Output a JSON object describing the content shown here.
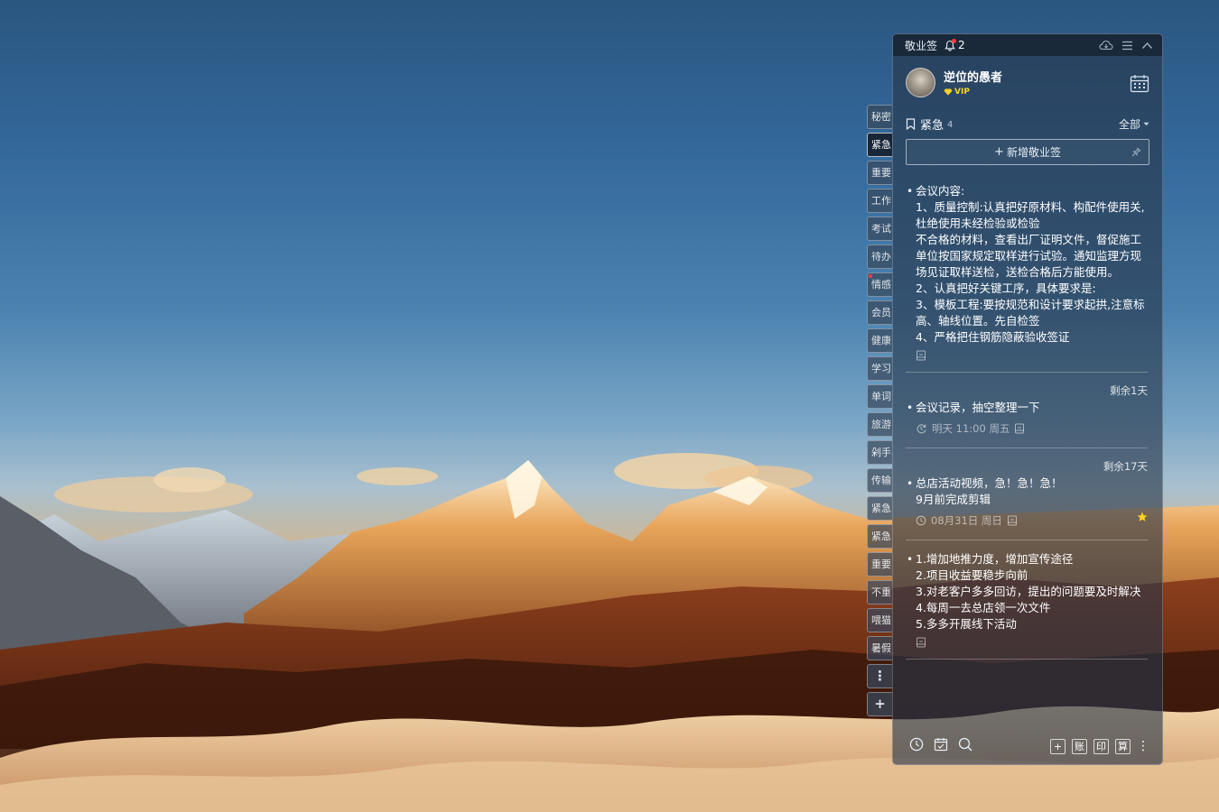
{
  "side_tabs": [
    {
      "label": "秘密",
      "active": false,
      "dot": false
    },
    {
      "label": "紧急",
      "active": true,
      "dot": false
    },
    {
      "label": "重要",
      "active": false,
      "dot": false
    },
    {
      "label": "工作",
      "active": false,
      "dot": false
    },
    {
      "label": "考试",
      "active": false,
      "dot": false
    },
    {
      "label": "待办",
      "active": false,
      "dot": false
    },
    {
      "label": "情感",
      "active": false,
      "dot": true
    },
    {
      "label": "会员",
      "active": false,
      "dot": false
    },
    {
      "label": "健康",
      "active": false,
      "dot": false
    },
    {
      "label": "学习",
      "active": false,
      "dot": false
    },
    {
      "label": "单词",
      "active": false,
      "dot": false
    },
    {
      "label": "旅游",
      "active": false,
      "dot": false
    },
    {
      "label": "剁手",
      "active": false,
      "dot": false
    },
    {
      "label": "传输",
      "active": false,
      "dot": false
    },
    {
      "label": "紧急",
      "active": false,
      "dot": false
    },
    {
      "label": "紧急",
      "active": false,
      "dot": false
    },
    {
      "label": "重要",
      "active": false,
      "dot": false
    },
    {
      "label": "不重",
      "active": false,
      "dot": false
    },
    {
      "label": "喂猫",
      "active": false,
      "dot": false
    },
    {
      "label": "暑假",
      "active": false,
      "dot": false
    }
  ],
  "side_more_glyph": "⋮",
  "side_add_glyph": "+",
  "window": {
    "app_name": "敬业签",
    "reminder_count": "2",
    "icons": [
      "cloud-sync-icon",
      "menu-icon",
      "collapse-icon"
    ]
  },
  "user": {
    "name": "逆位的愚者",
    "badge": "VIP"
  },
  "category": {
    "name": "紧急",
    "count": "4",
    "filter": "全部"
  },
  "new_note_label": "新增敬业签",
  "notes": [
    {
      "text": "会议内容:\n1、质量控制:认真把好原材料、构配件使用关,杜绝使用未经检验或检验\n不合格的材料，查看出厂证明文件，督促施工单位按国家规定取样进行试验。通知监理方现场见证取样送检，送检合格后方能使用。\n2、认真把好关键工序，具体要求是:\n3、模板工程:要按规范和设计要求起拱,注意标高、轴线位置。先自检签\n4、严格把住钢筋隐蔽验收签证",
      "remain": "",
      "time": ""
    },
    {
      "text": "会议记录，抽空整理一下",
      "remain": "剩余1天",
      "time": "明天 11:00 周五"
    },
    {
      "text": "总店活动视频，急！急！急！\n9月前完成剪辑",
      "remain": "剩余17天",
      "time": "08月31日 周日"
    },
    {
      "text": "1.增加地推力度，增加宣传途径\n2.项目收益要稳步向前\n3.对老客户多多回访，提出的问题要及时解决\n4.每周一去总店领一次文件\n5.多多开展线下活动",
      "remain": "",
      "time": ""
    }
  ],
  "bottom_bar": {
    "left_icons": [
      "clock-icon",
      "checklist-icon",
      "search-icon"
    ],
    "right_buttons": [
      "+",
      "账",
      "印",
      "算"
    ]
  }
}
